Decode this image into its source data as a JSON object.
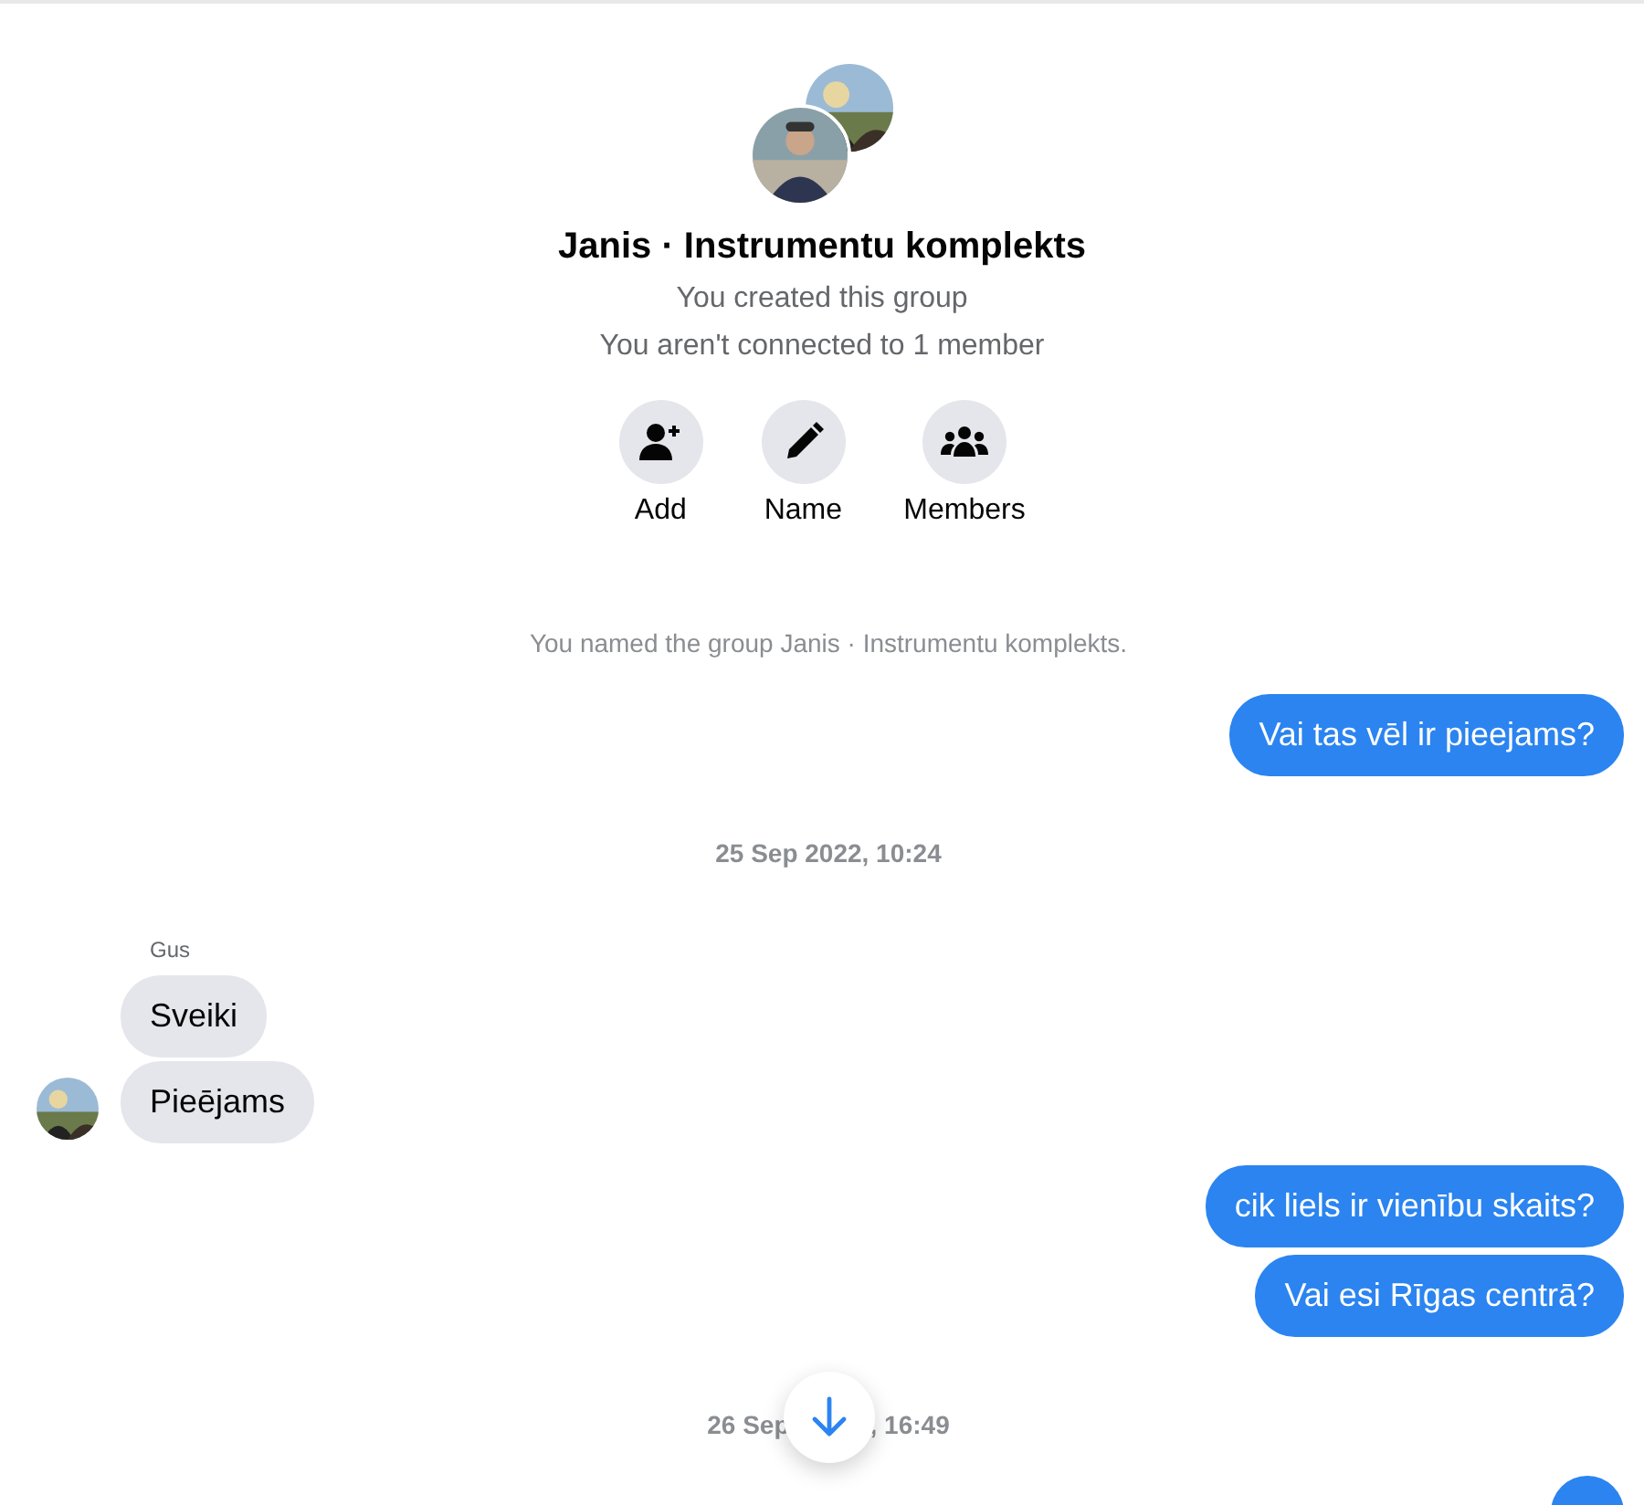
{
  "header": {
    "title": "Janis · Instrumentu komplekts",
    "subtitles": [
      "You created this group",
      "You aren't connected to 1 member"
    ],
    "actions": [
      {
        "kind": "add",
        "label": "Add"
      },
      {
        "kind": "name",
        "label": "Name"
      },
      {
        "kind": "members",
        "label": "Members"
      }
    ]
  },
  "messages": [
    {
      "kind": "system",
      "text": "You named the group Janis · Instrumentu komplekts."
    },
    {
      "kind": "outgoing",
      "text": "Vai tas vēl ir pieejams?"
    },
    {
      "kind": "timestamp",
      "text": "25 Sep 2022, 10:24"
    },
    {
      "kind": "incoming",
      "sender": "Gus",
      "texts": [
        "Sveiki",
        "Pieējams"
      ]
    },
    {
      "kind": "outgoing",
      "text": "cik liels ir vienību skaits?"
    },
    {
      "kind": "outgoing",
      "text": "Vai esi Rīgas centrā?"
    },
    {
      "kind": "timestamp_covered",
      "parts": [
        "26 Sep",
        ", 16:49"
      ]
    }
  ]
}
